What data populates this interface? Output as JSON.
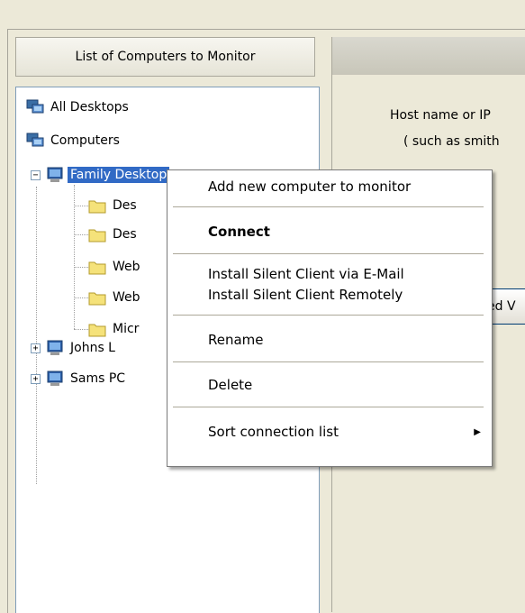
{
  "list_panel": {
    "header": "List of Computers to Monitor"
  },
  "tree": {
    "all_desktops": "All Desktops",
    "computers": "Computers",
    "family_desktop": "Family Desktop",
    "children": [
      "Des",
      "Des",
      "Web",
      "Web",
      "Micr"
    ],
    "johns": "Johns L",
    "sams": "Sams PC",
    "collapse_sign": "−",
    "expand_sign": "+"
  },
  "right_panel": {
    "host_label": "Host name or IP",
    "host_example": "( such as smith",
    "button_label": "ed V"
  },
  "context_menu": {
    "items": [
      {
        "label": "Add new computer to monitor",
        "bold": false
      },
      {
        "label": "Connect",
        "bold": true
      },
      {
        "label": "Install Silent Client via E-Mail",
        "bold": false
      },
      {
        "label": "Install Silent Client Remotely",
        "bold": false
      },
      {
        "label": "Rename",
        "bold": false
      },
      {
        "label": "Delete",
        "bold": false
      },
      {
        "label": "Sort connection list",
        "bold": false
      }
    ],
    "submenu_arrow": "▶"
  },
  "colors": {
    "selection": "#316ac5",
    "window_bg": "#ece9d8",
    "folder": "#f5e27a"
  }
}
